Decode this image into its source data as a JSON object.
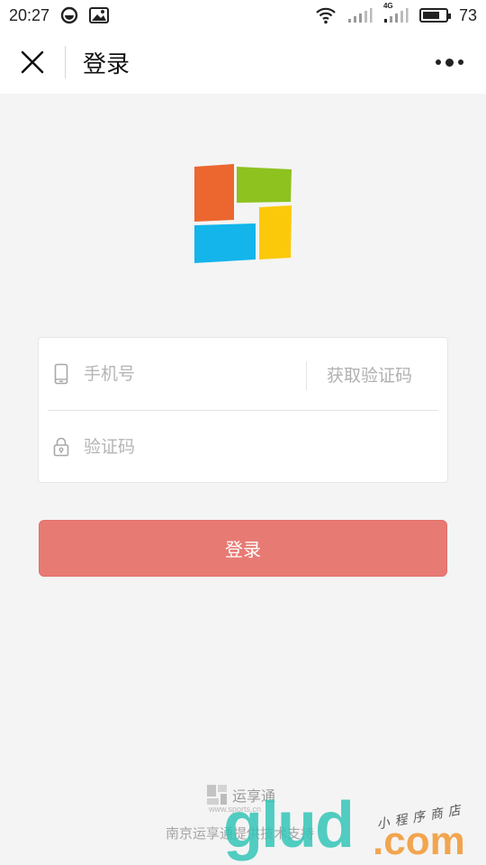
{
  "status_bar": {
    "time": "20:27",
    "battery_percent": "73",
    "battery_level": 0.73,
    "left_icons": [
      "sync-icon",
      "image-icon"
    ],
    "right_icons": [
      "wifi-icon",
      "signal-icon",
      "signal-4g-icon",
      "battery-icon"
    ],
    "network_label": "4G"
  },
  "navbar": {
    "title": "登录",
    "close_icon": "close-icon",
    "more_icon": "more-icon"
  },
  "logo": {
    "colors": [
      "#ec6630",
      "#8dc21f",
      "#13b5ea",
      "#fcc90a"
    ]
  },
  "form": {
    "phone_placeholder": "手机号",
    "phone_value": "",
    "get_code_label": "获取验证码",
    "code_placeholder": "验证码",
    "code_value": ""
  },
  "login_button": {
    "label": "登录",
    "color": "#e87a74"
  },
  "footer": {
    "brand_name": "运享通",
    "url": "www.sports.cn",
    "support_text": "南京运享通提供技术支持"
  },
  "watermark": {
    "main": "glud",
    "suffix": ".com",
    "caption": "小程序商店"
  }
}
